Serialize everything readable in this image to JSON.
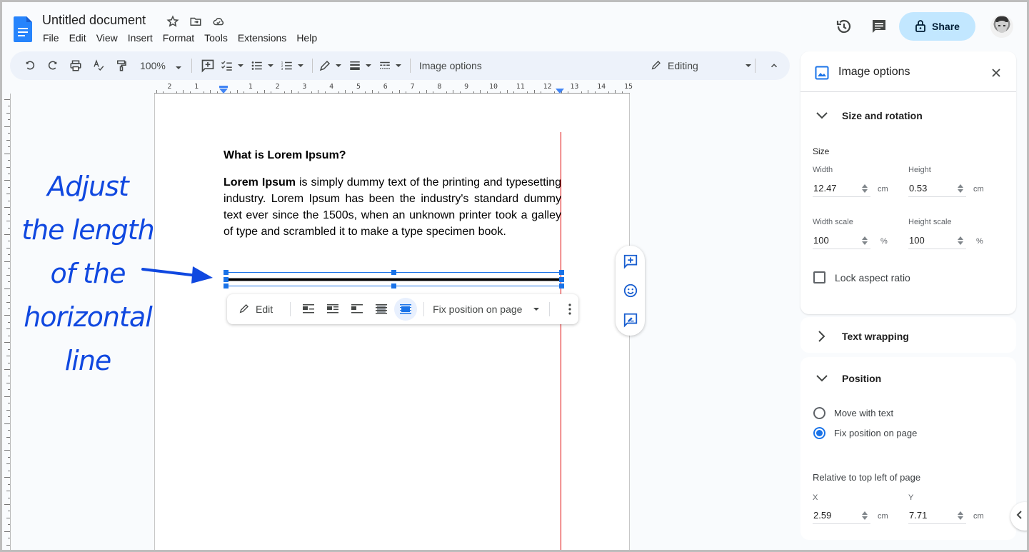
{
  "header": {
    "title": "Untitled document",
    "title_icons": [
      "star-icon",
      "move-to-folder-icon",
      "cloud-saved-icon"
    ],
    "menu": [
      "File",
      "Edit",
      "View",
      "Insert",
      "Format",
      "Tools",
      "Extensions",
      "Help"
    ],
    "share_label": "Share",
    "right_icons": [
      "version-history-icon",
      "comments-icon",
      "lock-icon",
      "avatar"
    ]
  },
  "toolbar": {
    "zoom": "100%",
    "image_options_label": "Image options",
    "mode_label": "Editing",
    "icons": [
      "undo-icon",
      "redo-icon",
      "print-icon",
      "spellcheck-icon",
      "paint-format-icon",
      "add-comment-icon",
      "checklist-icon",
      "bulleted-list-icon",
      "numbered-list-icon",
      "border-color-icon",
      "border-weight-icon",
      "border-dash-icon",
      "pencil-icon",
      "collapse-icon"
    ]
  },
  "ruler": {
    "labels": [
      "2",
      "1",
      "1",
      "2",
      "3",
      "4",
      "5",
      "6",
      "7",
      "8",
      "9",
      "10",
      "11",
      "12",
      "13",
      "14",
      "15"
    ]
  },
  "document": {
    "heading": "What is Lorem Ipsum?",
    "para_bold": "Lorem Ipsum",
    "para_rest": " is simply dummy text of the printing and typesetting industry. Lorem Ipsum has been the industry's standard dummy text ever since the 1500s, when an unknown printer took a galley of type and scrambled it to make a type specimen book."
  },
  "image_toolbar": {
    "edit_label": "Edit",
    "wrap_options": [
      "in-line-icon",
      "wrap-text-icon",
      "break-text-icon",
      "behind-text-icon",
      "in-front-of-text-icon"
    ],
    "active_wrap": "in-front-of-text-icon",
    "position_label": "Fix position on page"
  },
  "side_float": [
    "add-comment-icon",
    "add-emoji-reaction-icon",
    "suggest-edits-icon"
  ],
  "annotation": {
    "lines": [
      "Adjust",
      "the length",
      "of the",
      "horizontal",
      "line"
    ],
    "color": "#1048e0"
  },
  "panel": {
    "title": "Image options",
    "size_rotation": {
      "heading": "Size and rotation",
      "size_label": "Size",
      "width_label": "Width",
      "width_value": "12.47",
      "height_label": "Height",
      "height_value": "0.53",
      "unit": "cm",
      "width_scale_label": "Width scale",
      "width_scale_value": "100",
      "height_scale_label": "Height scale",
      "height_scale_value": "100",
      "scale_unit": "%",
      "lock_label": "Lock aspect ratio",
      "lock_checked": false
    },
    "text_wrapping": {
      "heading": "Text wrapping"
    },
    "position": {
      "heading": "Position",
      "options": [
        "Move with text",
        "Fix position on page"
      ],
      "selected": "Fix position on page",
      "relative_label": "Relative to top left of page",
      "x_label": "X",
      "x_value": "2.59",
      "y_label": "Y",
      "y_value": "7.71",
      "unit": "cm"
    }
  },
  "colors": {
    "accent": "#1a73e8",
    "share_bg": "#c2e7ff",
    "toolbar_bg": "#edf2fa",
    "margin_line": "#e00000"
  }
}
